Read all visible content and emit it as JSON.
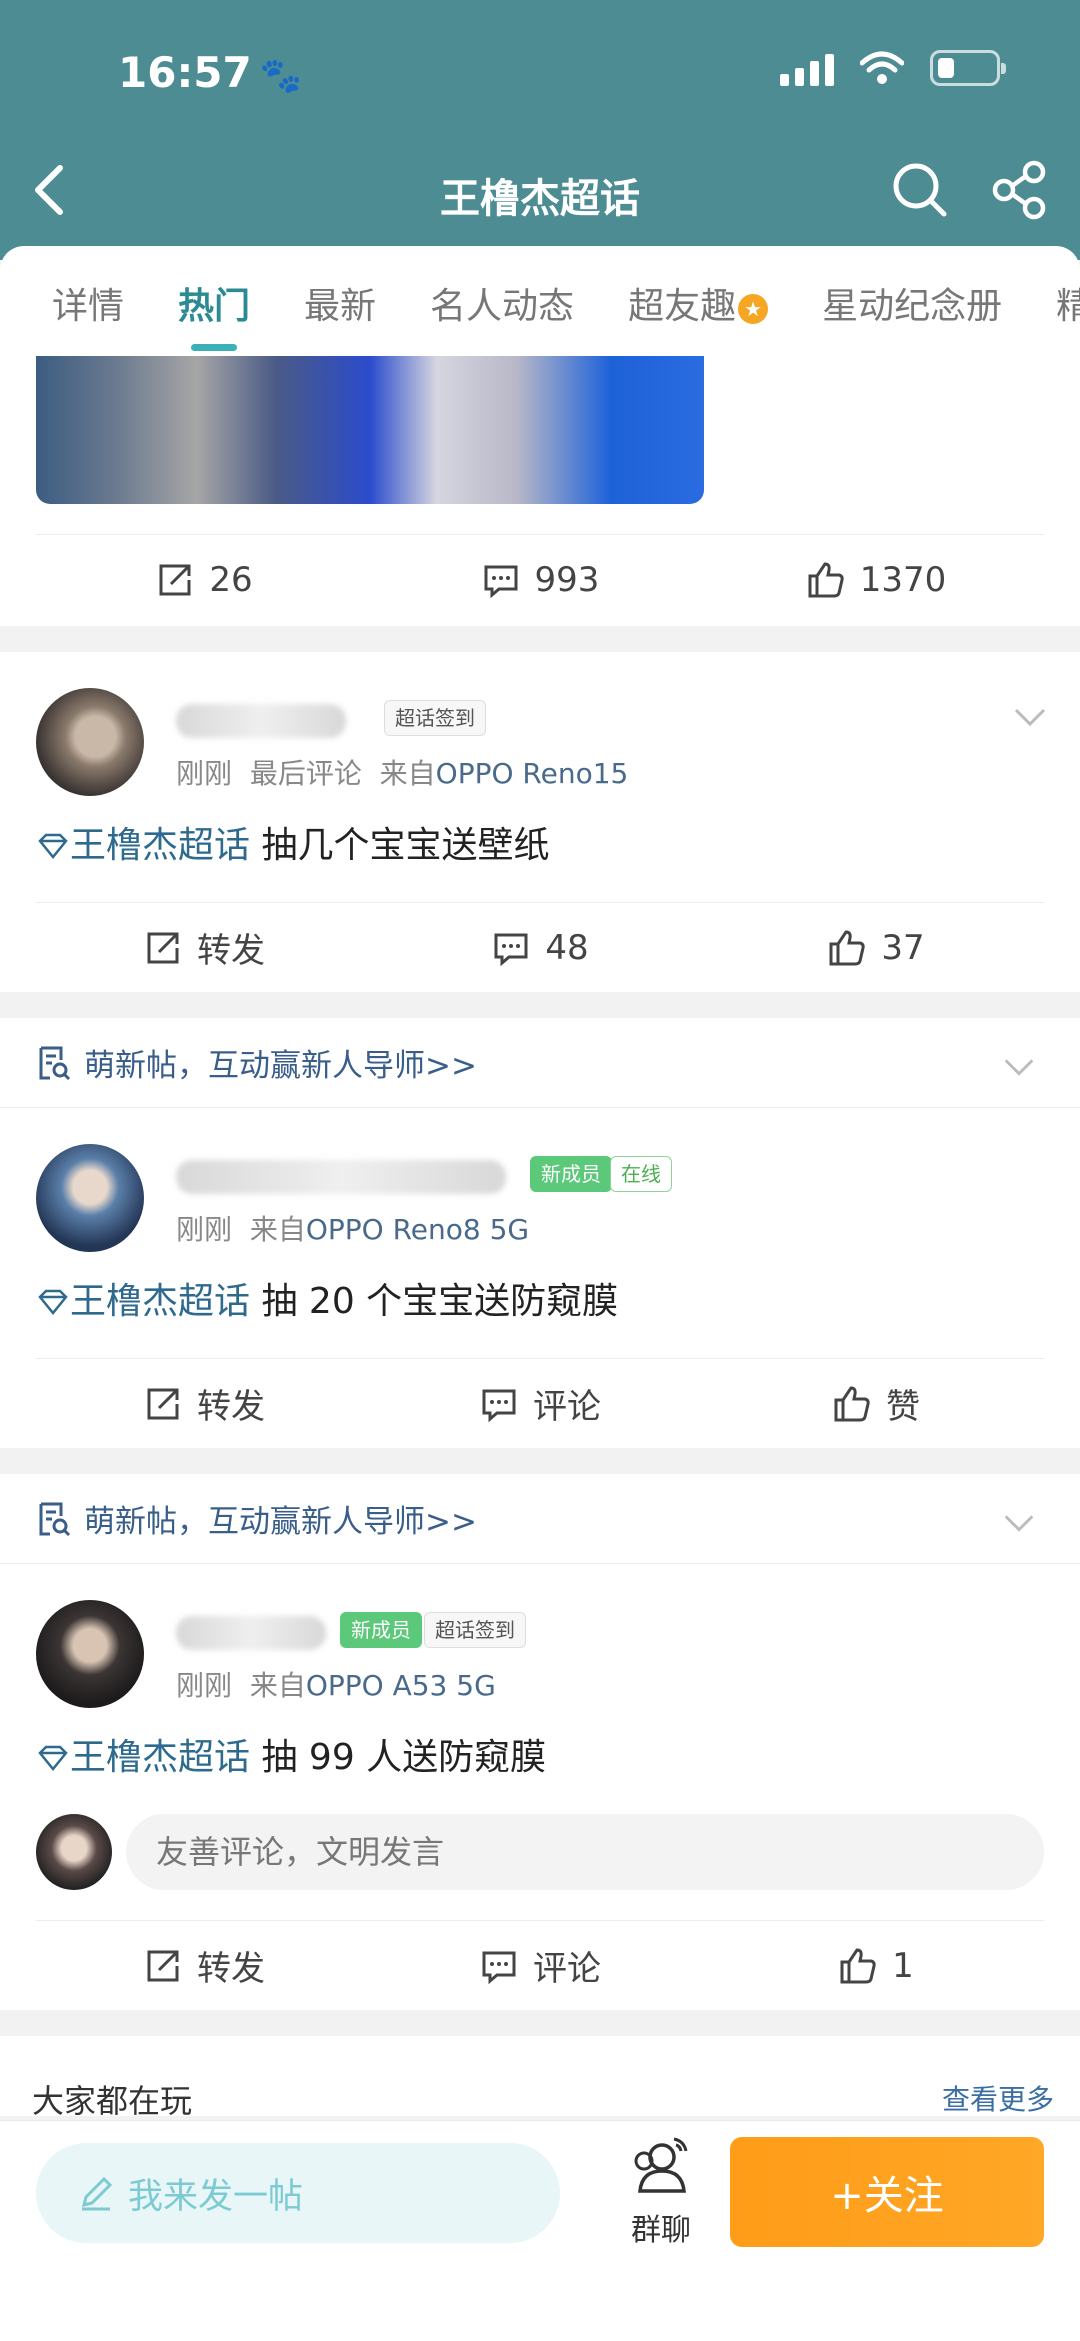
{
  "status_bar": {
    "time": "16:57",
    "paw_icon": "🐾"
  },
  "nav": {
    "title": "王橹杰超话"
  },
  "tabs": [
    {
      "label": "详情"
    },
    {
      "label": "热门"
    },
    {
      "label": "最新"
    },
    {
      "label": "名人动态"
    },
    {
      "label": "超友趣"
    },
    {
      "label": "星动纪念册"
    },
    {
      "label": "精"
    }
  ],
  "active_tab": "热门",
  "top_post": {
    "repost": "26",
    "comments": "993",
    "likes": "1370"
  },
  "posts": [
    {
      "badge_a": "超话签到",
      "time": "刚刚",
      "extra": "最后评论",
      "from": "来自",
      "device": "OPPO Reno15",
      "topic": "王橹杰超话",
      "text": "抽几个宝宝送壁纸",
      "repost": "转发",
      "comments": "48",
      "likes": "37"
    },
    {
      "promo": "萌新帖，互动赢新人导师>>",
      "badge_a": "新成员",
      "badge_b": "在线",
      "time": "刚刚",
      "from": "来自",
      "device": "OPPO Reno8 5G",
      "topic": "王橹杰超话",
      "text": "抽 20 个宝宝送防窥膜",
      "repost": "转发",
      "comments": "评论",
      "likes": "赞"
    },
    {
      "promo": "萌新帖，互动赢新人导师>>",
      "badge_a": "新成员",
      "badge_b": "超话签到",
      "time": "刚刚",
      "from": "来自",
      "device": "OPPO A53 5G",
      "topic": "王橹杰超话",
      "text": "抽 99 人送防窥膜",
      "comment_placeholder": "友善评论，文明发言",
      "repost": "转发",
      "comments": "评论",
      "likes": "1"
    }
  ],
  "others": {
    "title": "大家都在玩",
    "more": "查看更多"
  },
  "bottom": {
    "post_placeholder": "我来发一帖",
    "chat": "群聊",
    "follow": "+关注"
  },
  "colors": {
    "header": "#4d8c93",
    "accent": "#2c8a93",
    "follow": "#ff9c18",
    "topic": "#2e6a8e"
  }
}
